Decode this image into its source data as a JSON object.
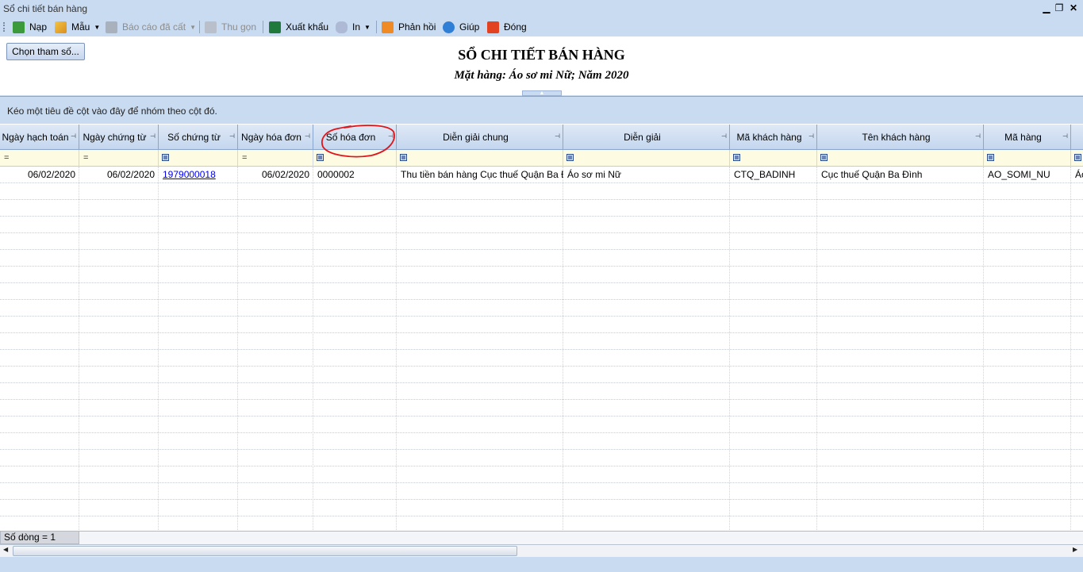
{
  "window": {
    "title": "Sổ chi tiết bán hàng"
  },
  "toolbar": {
    "reload": "Nạp",
    "template": "Mẫu",
    "saved_reports": "Báo cáo đã cất",
    "collapse": "Thu gọn",
    "export": "Xuất khẩu",
    "print": "In",
    "feedback": "Phản hồi",
    "help": "Giúp",
    "close": "Đóng"
  },
  "header": {
    "param_button": "Chọn tham số...",
    "title": "SỔ CHI TIẾT BÁN HÀNG",
    "subtitle": "Mặt hàng: Áo sơ mi Nữ; Năm 2020"
  },
  "grid": {
    "group_hint": "Kéo một tiêu đề cột vào đây để nhóm theo cột đó.",
    "columns": [
      "Ngày hạch toán",
      "Ngày chứng từ",
      "Số chứng từ",
      "Ngày hóa đơn",
      "Số hóa đơn",
      "Diễn giải chung",
      "Diễn giải",
      "Mã khách hàng",
      "Tên khách hàng",
      "Mã hàng"
    ],
    "filter_eq_symbol": "=",
    "rows": [
      [
        "06/02/2020",
        "06/02/2020",
        "1979000018",
        "06/02/2020",
        "0000002",
        "Thu tiền bán hàng Cục thuế Quận Ba Đì",
        "Áo sơ mi Nữ",
        "CTQ_BADINH",
        "Cục thuế Quận Ba Đình",
        "AO_SOMI_NU",
        "Áo"
      ]
    ]
  },
  "footer": {
    "row_count": "Số dòng = 1"
  },
  "colors": {
    "chrome": "#c9dbf1",
    "filter_row": "#fdfbe1",
    "link": "#0000ee",
    "annotation": "#e0151b"
  }
}
